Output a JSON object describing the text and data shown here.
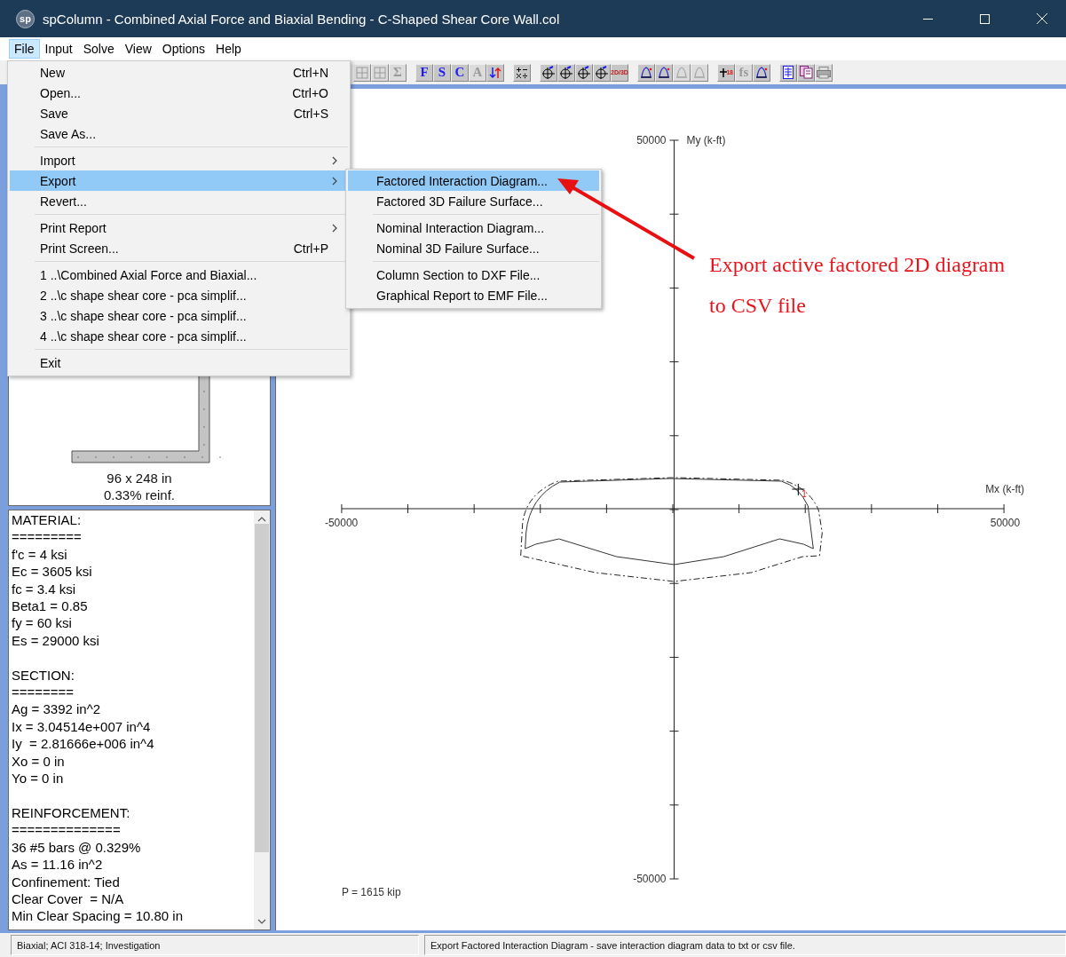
{
  "window": {
    "logo": "sp",
    "title": "spColumn - Combined Axial Force and Biaxial Bending - C-Shaped Shear Core Wall.col"
  },
  "menu_bar": [
    {
      "label": "File",
      "selected": true
    },
    {
      "label": "Input",
      "selected": false
    },
    {
      "label": "Solve",
      "selected": false
    },
    {
      "label": "View",
      "selected": false
    },
    {
      "label": "Options",
      "selected": false
    },
    {
      "label": "Help",
      "selected": false
    }
  ],
  "toolbar": {
    "groups": [
      {
        "buttons": [
          {
            "kind": "table",
            "disabled": true
          },
          {
            "kind": "table",
            "disabled": true
          },
          {
            "kind": "letter",
            "label": "Σ",
            "disabled": true
          }
        ]
      },
      {
        "buttons": [
          {
            "kind": "letter",
            "label": "F",
            "disabled": false
          },
          {
            "kind": "letter",
            "label": "S",
            "disabled": false
          },
          {
            "kind": "letter",
            "label": "C",
            "disabled": false
          },
          {
            "kind": "letter",
            "label": "A",
            "disabled": true
          },
          {
            "kind": "arrows",
            "disabled": false
          }
        ]
      },
      {
        "buttons": [
          {
            "kind": "operators",
            "disabled": false
          }
        ]
      },
      {
        "buttons": [
          {
            "kind": "axes",
            "disabled": false
          },
          {
            "kind": "axes",
            "disabled": false
          },
          {
            "kind": "axes",
            "disabled": false
          },
          {
            "kind": "axes",
            "disabled": false
          },
          {
            "kind": "scale",
            "label": "2D/3D",
            "disabled": false
          }
        ]
      },
      {
        "buttons": [
          {
            "kind": "bell",
            "disabled": false
          },
          {
            "kind": "bell",
            "disabled": false
          },
          {
            "kind": "bell",
            "disabled": true
          },
          {
            "kind": "bell",
            "disabled": true
          }
        ]
      },
      {
        "buttons": [
          {
            "kind": "plus",
            "label": "18",
            "disabled": false
          },
          {
            "kind": "letter",
            "label": "fs",
            "disabled": true
          },
          {
            "kind": "bell",
            "disabled": false
          }
        ]
      },
      {
        "buttons": [
          {
            "kind": "document",
            "disabled": false
          },
          {
            "kind": "report",
            "disabled": false
          },
          {
            "kind": "printer",
            "disabled": true
          }
        ]
      }
    ]
  },
  "file_menu": {
    "items": [
      {
        "kind": "item",
        "label": "New",
        "shortcut": "Ctrl+N",
        "submenu": false,
        "selected": false
      },
      {
        "kind": "item",
        "label": "Open...",
        "shortcut": "Ctrl+O",
        "submenu": false,
        "selected": false
      },
      {
        "kind": "item",
        "label": "Save",
        "shortcut": "Ctrl+S",
        "submenu": false,
        "selected": false
      },
      {
        "kind": "item",
        "label": "Save As...",
        "submenu": false,
        "selected": false
      },
      {
        "kind": "separator"
      },
      {
        "kind": "item",
        "label": "Import",
        "submenu": true,
        "selected": false
      },
      {
        "kind": "item",
        "label": "Export",
        "submenu": true,
        "selected": true
      },
      {
        "kind": "item",
        "label": "Revert...",
        "submenu": false,
        "selected": false
      },
      {
        "kind": "separator"
      },
      {
        "kind": "item",
        "label": "Print Report",
        "submenu": true,
        "selected": false
      },
      {
        "kind": "item",
        "label": "Print Screen...",
        "shortcut": "Ctrl+P",
        "submenu": false,
        "selected": false
      },
      {
        "kind": "separator"
      },
      {
        "kind": "item",
        "label": "1 ..\\Combined Axial Force and Biaxial...",
        "submenu": false,
        "selected": false
      },
      {
        "kind": "item",
        "label": "2 ..\\c shape shear core - pca simplif...",
        "submenu": false,
        "selected": false
      },
      {
        "kind": "item",
        "label": "3 ..\\c shape shear core - pca simplif...",
        "submenu": false,
        "selected": false
      },
      {
        "kind": "item",
        "label": "4 ..\\c shape shear core - pca simplif...",
        "submenu": false,
        "selected": false
      },
      {
        "kind": "separator"
      },
      {
        "kind": "item",
        "label": "Exit",
        "submenu": false,
        "selected": false
      }
    ]
  },
  "export_submenu": {
    "items": [
      {
        "kind": "item",
        "label": "Factored Interaction Diagram...",
        "selected": true
      },
      {
        "kind": "item",
        "label": "Factored 3D Failure Surface...",
        "selected": false
      },
      {
        "kind": "separator"
      },
      {
        "kind": "item",
        "label": "Nominal Interaction Diagram...",
        "selected": false
      },
      {
        "kind": "item",
        "label": "Nominal 3D Failure Surface...",
        "selected": false
      },
      {
        "kind": "separator"
      },
      {
        "kind": "item",
        "label": "Column Section to DXF File...",
        "selected": false
      },
      {
        "kind": "item",
        "label": "Graphical Report to EMF File...",
        "selected": false
      }
    ]
  },
  "section_view": {
    "dimensions": "96 x 248 in",
    "reinforcement": "0.33% reinf."
  },
  "report": {
    "sections": [
      {
        "title": "MATERIAL:",
        "rule": "=========",
        "lines": [
          "f'c = 4 ksi",
          "Ec = 3605 ksi",
          "fc = 3.4 ksi",
          "Beta1 = 0.85",
          "fy = 60 ksi",
          "Es = 29000 ksi"
        ]
      },
      {
        "title": "SECTION:",
        "rule": "========",
        "lines": [
          "Ag = 3392 in^2",
          "Ix = 3.04514e+007 in^4",
          "Iy  = 2.81666e+006 in^4",
          "Xo = 0 in",
          "Yo = 0 in"
        ]
      },
      {
        "title": "REINFORCEMENT:",
        "rule": "==============",
        "lines": [
          "36 #5 bars @ 0.329%",
          "As = 11.16 in^2",
          "Confinement: Tied",
          "Clear Cover  = N/A",
          "Min Clear Spacing = 10.80 in"
        ]
      }
    ]
  },
  "diagram": {
    "y_axis_label": "My (k-ft)",
    "x_axis_label": "Mx (k-ft)",
    "y_max_label": "50000",
    "y_min_label": "-50000",
    "x_min_label": "-50000",
    "x_max_label": "50000",
    "load_label": "P = 1615 kip",
    "marker_label": "1"
  },
  "annotation": {
    "lines": [
      "Export active factored 2D diagram",
      "to CSV file"
    ]
  },
  "status_bar": [
    "Biaxial; ACI 318-14; Investigation",
    "Export Factored Interaction Diagram - save interaction diagram data to txt or csv file."
  ]
}
